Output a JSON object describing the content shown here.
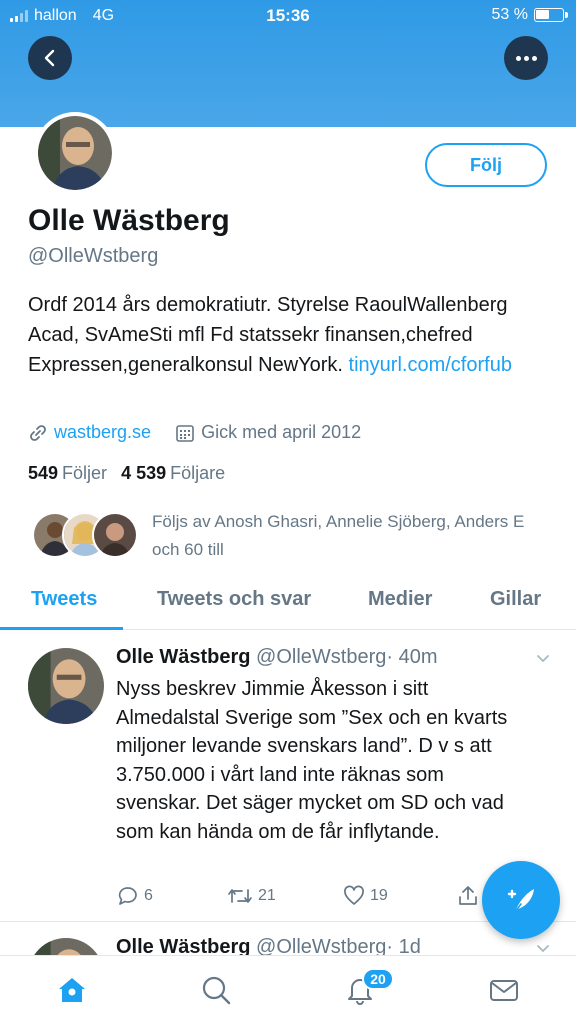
{
  "status_bar": {
    "carrier": "hallon",
    "network": "4G",
    "time": "15:36",
    "battery_text": "53 %",
    "battery_level": 0.53
  },
  "profile": {
    "name": "Olle Wästberg",
    "handle": "@OlleWstberg",
    "follow_label": "Följ",
    "bio_text": "Ordf 2014 års demokratiutr. Styrelse RaoulWallenberg Acad, SvAmeSti mfl Fd statssekr finansen,chefred Expressen,generalkonsul NewYork. ",
    "bio_link": "tinyurl.com/cforfub",
    "website": "wastberg.se",
    "joined": "Gick med april 2012",
    "following_count": "549",
    "following_label": "Följer",
    "followers_count": "4 539",
    "followers_label": "Följare",
    "followed_by": "Följs av Anosh Ghasri, Annelie Sjöberg, Anders E och 60 till"
  },
  "tabs": [
    {
      "label": "Tweets",
      "active": true
    },
    {
      "label": "Tweets och svar",
      "active": false
    },
    {
      "label": "Medier",
      "active": false
    },
    {
      "label": "Gillar",
      "active": false
    }
  ],
  "tweets": [
    {
      "name": "Olle Wästberg",
      "handle": "@OlleWstberg",
      "time": "· 40m",
      "text": "Nyss beskrev Jimmie Åkesson i sitt Almedalstal Sverige som ”Sex och en kvarts miljoner levande svenskars land”. D v s att 3.750.000 i vårt land inte räknas som svenskar. Det säger mycket om SD och vad som kan hända om de får inflytande.",
      "replies": "6",
      "retweets": "21",
      "likes": "19"
    },
    {
      "name": "Olle Wästberg",
      "handle": "@OlleWstberg",
      "time": "· 1d"
    }
  ],
  "bottom_nav": {
    "notifications_badge": "20",
    "icons": [
      "home-icon",
      "search-icon",
      "bell-icon",
      "mail-icon"
    ]
  },
  "colors": {
    "accent": "#1da1f2",
    "banner": "#3a9fe7",
    "nav_button": "#1e3650",
    "secondary_text": "#657786"
  }
}
